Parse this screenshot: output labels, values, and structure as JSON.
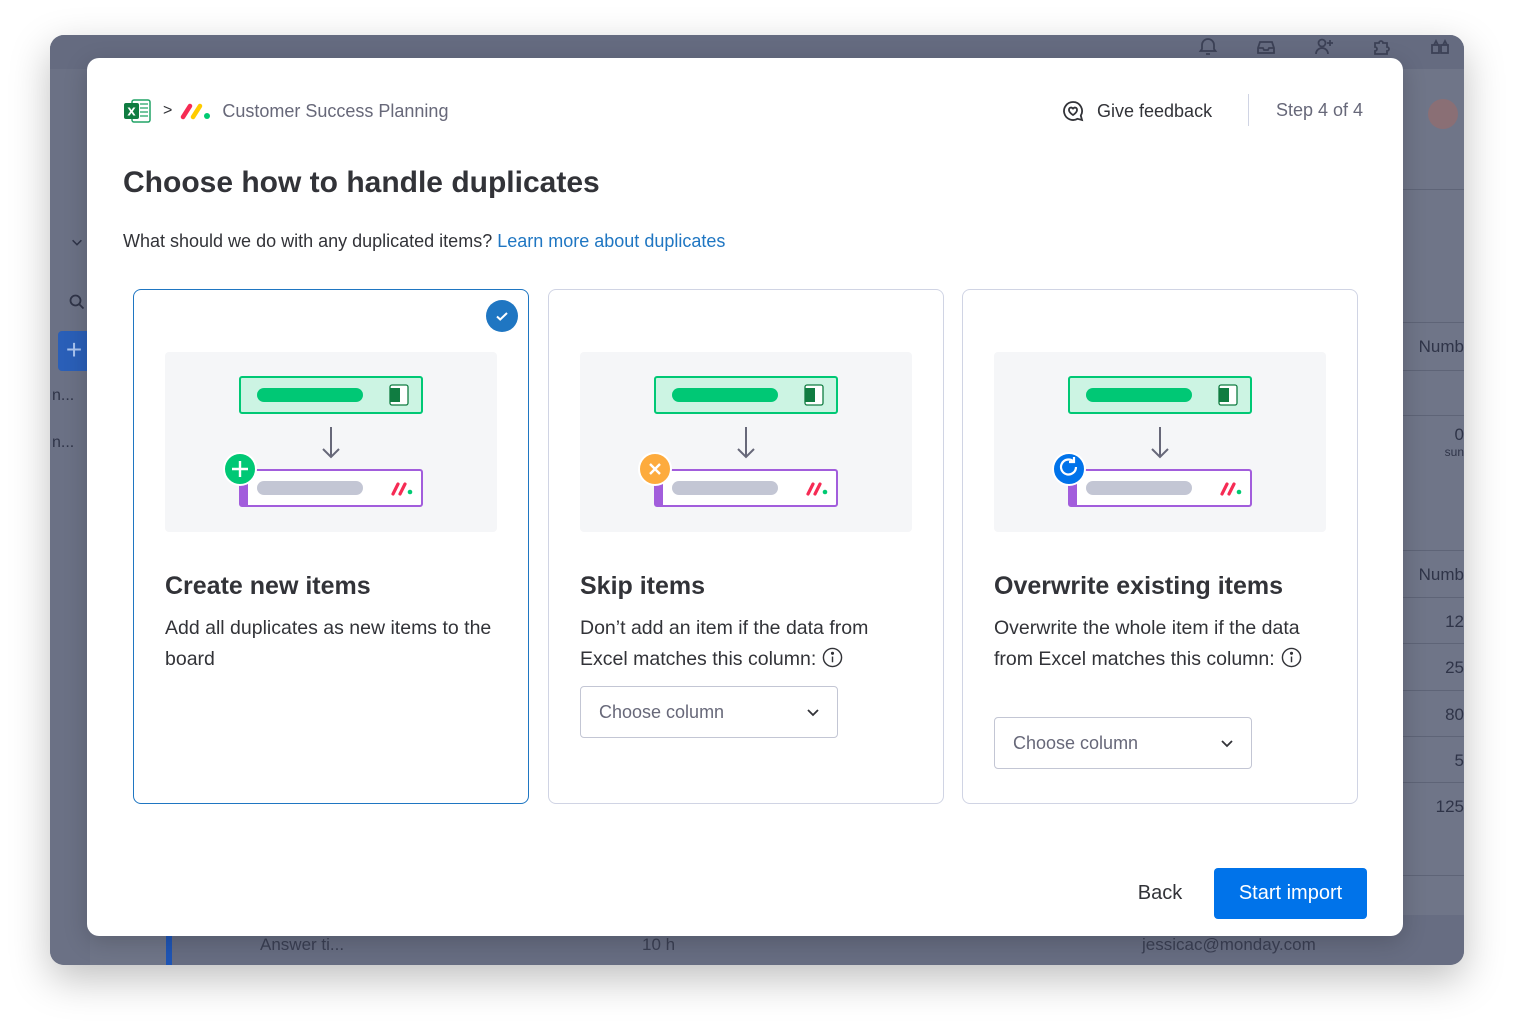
{
  "background": {
    "left_texts": [
      "n...",
      "n..."
    ],
    "right_column": {
      "header_1": "Numb",
      "value_1": "0",
      "sub_1": "sun",
      "header_2": "Numb",
      "values": [
        "12",
        "25",
        "80",
        "5",
        "125"
      ]
    },
    "bottom_row": {
      "item": "Answer ti...",
      "hours": "10 h",
      "email": "jessicac@monday.com"
    },
    "icons": [
      "bell-icon",
      "inbox-icon",
      "invite-icon",
      "puzzle-icon",
      "apps-icon"
    ]
  },
  "modal": {
    "breadcrumb": {
      "separator": ">",
      "board_name": "Customer Success Planning"
    },
    "feedback_label": "Give feedback",
    "step_label": "Step 4 of 4",
    "title": "Choose how to handle duplicates",
    "question": "What should we do with any duplicated items?",
    "learn_more": "Learn more about duplicates",
    "options": [
      {
        "title": "Create new items",
        "desc": "Add all duplicates as new items to the board",
        "selected": true
      },
      {
        "title": "Skip items",
        "desc": "Don’t add an item if the data from Excel matches this column:",
        "select_placeholder": "Choose column",
        "selected": false
      },
      {
        "title": "Overwrite existing items",
        "desc": "Overwrite the whole item if the data from Excel matches this column:",
        "select_placeholder": "Choose column",
        "selected": false
      }
    ],
    "back_label": "Back",
    "start_label": "Start import"
  },
  "colors": {
    "primary": "#0073ea",
    "link": "#1f76c2",
    "excel_green": "#00c875",
    "monday_purple": "#a25ddc",
    "plus_green": "#00c875",
    "skip_orange": "#fdab3d",
    "overwrite_blue": "#0073ea"
  }
}
